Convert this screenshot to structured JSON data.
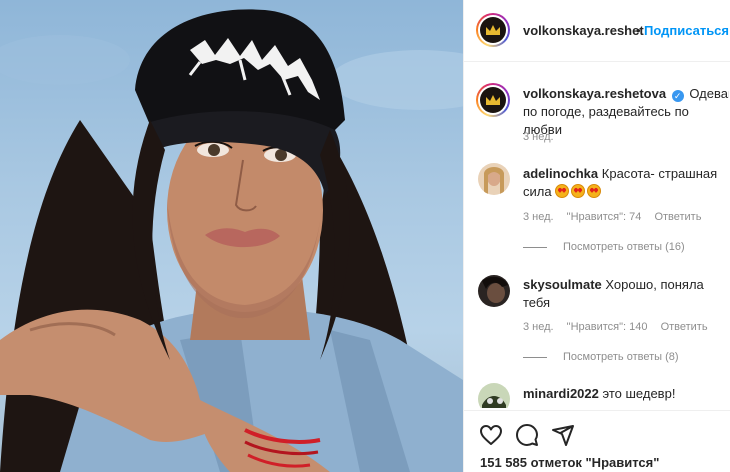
{
  "post": {
    "image_alt": "Portrait of a woman in a black cap with white graffiti-style lettering"
  },
  "header": {
    "username": "volkonskaya.reshet",
    "dot": "•",
    "follow_label": "Подписаться",
    "avatar_icon": "crown-icon"
  },
  "caption": {
    "username": "volkonskaya.reshetova",
    "verified_icon": "verified-badge-icon",
    "text": "Одевайтесь по погоде, раздевайтесь по любви",
    "time": "3 нед."
  },
  "comments": [
    {
      "username": "adelinochka",
      "text": "Красота- страшная сила",
      "emoji_count": 3,
      "emoji_icon": "heart-eyes-emoji",
      "time": "3 нед.",
      "likes": "\"Нравится\": 74",
      "reply": "Ответить",
      "view_replies": "Посмотреть ответы (16)"
    },
    {
      "username": "skysoulmate",
      "text": "Хорошо, поняла тебя",
      "time": "3 нед.",
      "likes": "\"Нравится\": 140",
      "reply": "Ответить",
      "view_replies": "Посмотреть ответы (8)"
    },
    {
      "username": "minardi2022",
      "text": "это шедевр!"
    }
  ],
  "actions": {
    "like_icon": "heart-icon",
    "comment_icon": "comment-icon",
    "share_icon": "share-icon",
    "likes_text": "151 585 отметок \"Нравится\""
  },
  "colors": {
    "link_blue": "#0095f6",
    "text": "#262626",
    "muted": "#8e8e8e",
    "verified_blue": "#3897f0"
  }
}
